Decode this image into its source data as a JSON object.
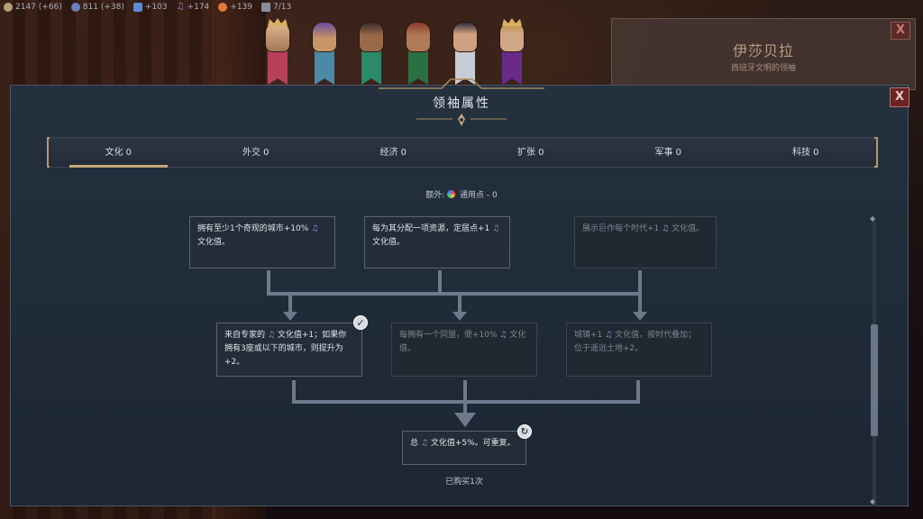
{
  "resources": [
    {
      "icon": "gold-icon",
      "color": "#b6a07a",
      "text": "2147 (+66)"
    },
    {
      "icon": "faith-icon",
      "color": "#6a7fbf",
      "text": "811 (+38)"
    },
    {
      "icon": "science-icon",
      "color": "#5a8bd8",
      "text": "+103"
    },
    {
      "icon": "culture-icon",
      "color": "#9a7adf",
      "text": "+174"
    },
    {
      "icon": "happiness-icon",
      "color": "#e07a3a",
      "text": "+139"
    },
    {
      "icon": "city-icon",
      "color": "#8a8f99",
      "text": "7/13"
    }
  ],
  "leader_card": {
    "name": "伊莎贝拉",
    "subtitle": "西班牙文明的领袖",
    "close": "X"
  },
  "dialog": {
    "title": "领袖属性",
    "close": "X"
  },
  "tabs": [
    "文化 0",
    "外交 0",
    "经济 0",
    "扩张 0",
    "军事 0",
    "科技 0"
  ],
  "active_tab": 0,
  "extra": {
    "prefix": "额外:",
    "points": "通用点 - 0"
  },
  "tree": {
    "row1": [
      {
        "text": "拥有至少1个奇观的城市+10% ♫ 文化值。",
        "dim": false
      },
      {
        "text": "每为其分配一项资源，定居点+1 ♫ 文化值。",
        "dim": false
      },
      {
        "text": "展示巨作每个时代+1 ♫ 文化值。",
        "dim": true
      }
    ],
    "row2": [
      {
        "text": "来自专家的 ♫ 文化值+1；如果你拥有3座或以下的城市，则提升为+2。",
        "dim": false,
        "owned": true
      },
      {
        "text": "每拥有一个同盟，便+10% ♫ 文化值。",
        "dim": true
      },
      {
        "text": "城镇+1 ♫ 文化值，按时代叠加；位于遥远土地+2。",
        "dim": true
      }
    ],
    "final": {
      "text": "总 ♫ 文化值+5%。可重复。",
      "repeatable": true
    },
    "bought": "已购买1次"
  },
  "colors": {
    "accent": "#c8a67a",
    "panel": "#1d2733",
    "connector": "#6e7a8c",
    "close_red": "#6a2426"
  }
}
